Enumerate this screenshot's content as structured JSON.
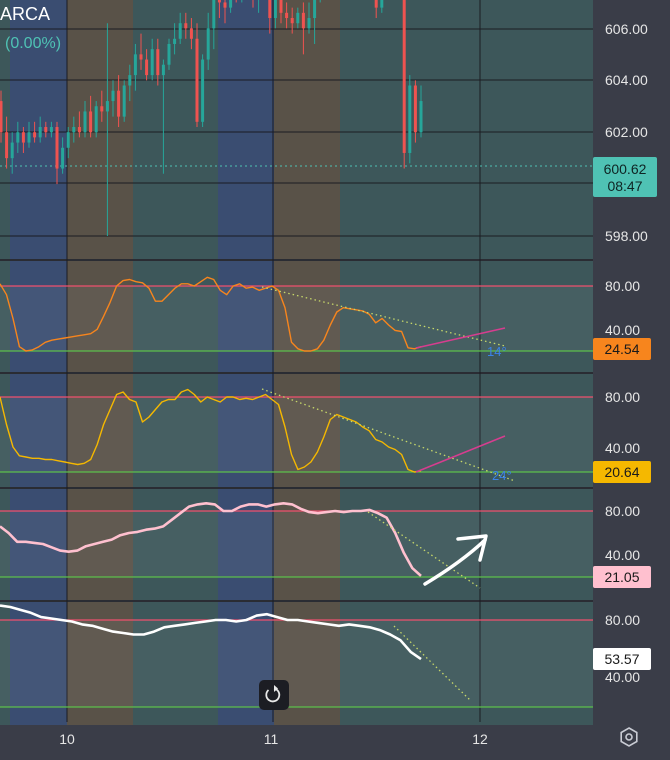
{
  "header": {
    "symbol": "ARCA",
    "change": "(0.00%)"
  },
  "colors": {
    "background": "#3a3d48",
    "zone_blue": "#3b4f75",
    "zone_orange": "#5d5448",
    "zone_teal": "#3e5a5c",
    "candle_up": "#26a69a",
    "candle_down": "#ef5350",
    "grid": "#1b1c22",
    "upper_band": "#f0506e",
    "lower_band": "#5cc04b",
    "osc1": "#f7851d",
    "osc2": "#f5b800",
    "osc3": "#ffc0cf",
    "osc4": "#ffffff",
    "trend_up_line": "#d63d8f",
    "trend_down_dots": "#c7d86a",
    "angle_text": "#3b82e8",
    "price_badge": "#4fc2b4"
  },
  "x_axis": {
    "labels": [
      "10",
      "11",
      "12"
    ]
  },
  "settings_icon": "gear-icon",
  "reset_icon": "reset-icon",
  "chart_data": [
    {
      "type": "candlestick",
      "title": "ARCA",
      "y_ticks": [
        "606.00",
        "604.00",
        "602.00",
        "598.00"
      ],
      "ylim": [
        597.9,
        607.2
      ],
      "last_price": "600.62",
      "countdown": "08:47",
      "grid": true,
      "candles": [
        {
          "o": 600.6,
          "h": 600.8,
          "l": 599.8,
          "c": 600.0
        },
        {
          "o": 600.0,
          "h": 600.3,
          "l": 599.3,
          "c": 599.5
        },
        {
          "o": 599.5,
          "h": 600.0,
          "l": 599.2,
          "c": 599.8
        },
        {
          "o": 599.8,
          "h": 600.2,
          "l": 599.6,
          "c": 600.0
        },
        {
          "o": 600.0,
          "h": 600.1,
          "l": 599.6,
          "c": 599.8
        },
        {
          "o": 599.8,
          "h": 600.2,
          "l": 599.7,
          "c": 600.0
        },
        {
          "o": 600.0,
          "h": 600.2,
          "l": 599.8,
          "c": 599.9
        },
        {
          "o": 599.9,
          "h": 600.3,
          "l": 599.8,
          "c": 600.1
        },
        {
          "o": 600.1,
          "h": 600.2,
          "l": 599.9,
          "c": 600.0
        },
        {
          "o": 600.0,
          "h": 600.2,
          "l": 599.9,
          "c": 600.1
        },
        {
          "o": 600.1,
          "h": 600.2,
          "l": 599.0,
          "c": 599.3
        },
        {
          "o": 599.3,
          "h": 599.9,
          "l": 599.2,
          "c": 599.7
        },
        {
          "o": 599.7,
          "h": 600.1,
          "l": 599.5,
          "c": 600.0
        },
        {
          "o": 600.0,
          "h": 600.3,
          "l": 599.8,
          "c": 600.1
        },
        {
          "o": 600.1,
          "h": 600.4,
          "l": 599.9,
          "c": 600.0
        },
        {
          "o": 600.0,
          "h": 600.6,
          "l": 599.9,
          "c": 600.4
        },
        {
          "o": 600.4,
          "h": 600.7,
          "l": 599.9,
          "c": 600.0
        },
        {
          "o": 600.0,
          "h": 600.6,
          "l": 599.9,
          "c": 600.5
        },
        {
          "o": 600.5,
          "h": 600.8,
          "l": 600.2,
          "c": 600.4
        },
        {
          "o": 600.4,
          "h": 602.1,
          "l": 598.0,
          "c": 600.6
        },
        {
          "o": 600.6,
          "h": 601.0,
          "l": 600.3,
          "c": 600.8
        },
        {
          "o": 600.8,
          "h": 601.1,
          "l": 600.1,
          "c": 600.3
        },
        {
          "o": 600.3,
          "h": 601.0,
          "l": 600.2,
          "c": 600.9
        },
        {
          "o": 600.9,
          "h": 601.3,
          "l": 600.6,
          "c": 601.1
        },
        {
          "o": 601.1,
          "h": 601.7,
          "l": 600.8,
          "c": 601.5
        },
        {
          "o": 601.5,
          "h": 601.9,
          "l": 601.2,
          "c": 601.4
        },
        {
          "o": 601.4,
          "h": 601.6,
          "l": 601.0,
          "c": 601.1
        },
        {
          "o": 601.1,
          "h": 601.8,
          "l": 601.0,
          "c": 601.6
        },
        {
          "o": 601.6,
          "h": 601.8,
          "l": 600.9,
          "c": 601.1
        },
        {
          "o": 601.1,
          "h": 601.4,
          "l": 599.2,
          "c": 601.3
        },
        {
          "o": 601.3,
          "h": 601.8,
          "l": 601.2,
          "c": 601.7
        },
        {
          "o": 601.7,
          "h": 602.1,
          "l": 601.5,
          "c": 601.8
        },
        {
          "o": 601.8,
          "h": 602.3,
          "l": 601.7,
          "c": 602.1
        },
        {
          "o": 602.1,
          "h": 602.3,
          "l": 601.8,
          "c": 602.0
        },
        {
          "o": 602.0,
          "h": 602.2,
          "l": 601.6,
          "c": 601.8
        },
        {
          "o": 601.8,
          "h": 602.1,
          "l": 600.1,
          "c": 600.2
        },
        {
          "o": 600.2,
          "h": 601.5,
          "l": 600.1,
          "c": 601.4
        },
        {
          "o": 601.4,
          "h": 602.3,
          "l": 601.2,
          "c": 602.0
        },
        {
          "o": 602.0,
          "h": 602.9,
          "l": 601.6,
          "c": 602.8
        },
        {
          "o": 602.8,
          "h": 603.1,
          "l": 602.2,
          "c": 602.5
        },
        {
          "o": 602.5,
          "h": 602.9,
          "l": 602.1,
          "c": 602.4
        },
        {
          "o": 602.4,
          "h": 603.0,
          "l": 602.3,
          "c": 602.9
        },
        {
          "o": 602.9,
          "h": 603.2,
          "l": 602.5,
          "c": 602.7
        },
        {
          "o": 602.7,
          "h": 603.0,
          "l": 602.5,
          "c": 602.8
        },
        {
          "o": 602.8,
          "h": 603.1,
          "l": 602.6,
          "c": 602.7
        },
        {
          "o": 602.7,
          "h": 603.0,
          "l": 602.4,
          "c": 602.6
        },
        {
          "o": 602.6,
          "h": 602.9,
          "l": 602.3,
          "c": 602.8
        },
        {
          "o": 602.8,
          "h": 603.6,
          "l": 602.7,
          "c": 603.1
        },
        {
          "o": 603.1,
          "h": 603.3,
          "l": 601.9,
          "c": 602.2
        },
        {
          "o": 602.2,
          "h": 602.8,
          "l": 602.0,
          "c": 602.6
        },
        {
          "o": 602.6,
          "h": 602.7,
          "l": 602.1,
          "c": 602.3
        },
        {
          "o": 602.3,
          "h": 602.5,
          "l": 602.0,
          "c": 602.2
        },
        {
          "o": 602.2,
          "h": 602.4,
          "l": 601.9,
          "c": 602.1
        },
        {
          "o": 602.1,
          "h": 602.4,
          "l": 602.0,
          "c": 602.3
        },
        {
          "o": 602.3,
          "h": 602.5,
          "l": 601.5,
          "c": 602.0
        },
        {
          "o": 602.0,
          "h": 602.5,
          "l": 601.9,
          "c": 602.2
        },
        {
          "o": 602.2,
          "h": 602.8,
          "l": 601.7,
          "c": 602.7
        },
        {
          "o": 602.7,
          "h": 603.7,
          "l": 602.5,
          "c": 603.5
        },
        {
          "o": 603.5,
          "h": 604.0,
          "l": 603.0,
          "c": 603.1
        },
        {
          "o": 603.1,
          "h": 606.6,
          "l": 602.9,
          "c": 604.4
        },
        {
          "o": 604.4,
          "h": 604.6,
          "l": 603.5,
          "c": 603.7
        },
        {
          "o": 603.7,
          "h": 604.2,
          "l": 603.0,
          "c": 603.2
        },
        {
          "o": 603.2,
          "h": 605.1,
          "l": 603.1,
          "c": 604.8
        },
        {
          "o": 604.8,
          "h": 605.2,
          "l": 604.5,
          "c": 605.0
        },
        {
          "o": 605.0,
          "h": 605.2,
          "l": 604.2,
          "c": 604.4
        },
        {
          "o": 604.4,
          "h": 604.7,
          "l": 604.0,
          "c": 604.5
        },
        {
          "o": 604.5,
          "h": 604.9,
          "l": 603.6,
          "c": 603.8
        },
        {
          "o": 603.8,
          "h": 604.1,
          "l": 602.2,
          "c": 602.4
        },
        {
          "o": 602.4,
          "h": 603.7,
          "l": 602.3,
          "c": 603.5
        },
        {
          "o": 603.5,
          "h": 603.9,
          "l": 602.9,
          "c": 603.1
        },
        {
          "o": 603.1,
          "h": 604.7,
          "l": 603.0,
          "c": 604.6
        },
        {
          "o": 604.6,
          "h": 604.7,
          "l": 602.8,
          "c": 603.1
        },
        {
          "o": 603.1,
          "h": 603.2,
          "l": 599.3,
          "c": 599.6
        },
        {
          "o": 599.6,
          "h": 601.1,
          "l": 599.4,
          "c": 600.9
        },
        {
          "o": 600.9,
          "h": 601.0,
          "l": 599.8,
          "c": 600.0
        },
        {
          "o": 600.0,
          "h": 600.9,
          "l": 599.9,
          "c": 600.6
        }
      ]
    },
    {
      "type": "line",
      "value_label": "24.54",
      "y_ticks": [
        "80.00",
        "40.00"
      ],
      "ylim": [
        10,
        100
      ],
      "bands": [
        80,
        20
      ],
      "angle_label": "14°",
      "values": [
        82,
        72,
        50,
        24,
        20,
        21,
        24,
        28,
        30,
        31,
        32,
        33,
        34,
        35,
        36,
        40,
        52,
        65,
        80,
        85,
        86,
        84,
        83,
        78,
        66,
        66,
        72,
        78,
        82,
        82,
        80,
        84,
        88,
        86,
        76,
        72,
        80,
        82,
        78,
        79,
        76,
        78,
        80,
        76,
        60,
        28,
        22,
        20,
        20,
        22,
        30,
        44,
        56,
        60,
        59,
        58,
        57,
        54,
        46,
        50,
        44,
        39,
        38,
        23,
        22,
        24
      ]
    },
    {
      "type": "line",
      "value_label": "20.64",
      "y_ticks": [
        "80.00",
        "40.00"
      ],
      "ylim": [
        10,
        100
      ],
      "bands": [
        80,
        20
      ],
      "angle_label": "24°",
      "values": [
        80,
        58,
        40,
        33,
        32,
        31,
        31,
        30,
        30,
        29,
        28,
        27,
        26,
        27,
        30,
        42,
        58,
        70,
        82,
        84,
        78,
        76,
        60,
        64,
        70,
        76,
        78,
        78,
        84,
        86,
        82,
        76,
        80,
        78,
        76,
        80,
        80,
        78,
        79,
        78,
        80,
        82,
        78,
        74,
        56,
        34,
        22,
        24,
        28,
        36,
        48,
        62,
        66,
        64,
        62,
        60,
        56,
        53,
        46,
        44,
        40,
        38,
        34,
        22,
        20,
        21
      ]
    },
    {
      "type": "line",
      "value_label": "21.05",
      "y_ticks": [
        "80.00",
        "40.00"
      ],
      "ylim": [
        10,
        100
      ],
      "bands": [
        80,
        20
      ],
      "values": [
        66,
        60,
        52,
        52,
        51,
        50,
        47,
        44,
        43,
        44,
        48,
        50,
        52,
        54,
        58,
        60,
        61,
        63,
        64,
        66,
        72,
        78,
        84,
        86,
        87,
        86,
        80,
        80,
        84,
        86,
        86,
        84,
        86,
        87,
        86,
        82,
        79,
        78,
        79,
        80,
        79,
        80,
        80,
        81,
        78,
        74,
        60,
        42,
        28,
        21
      ]
    },
    {
      "type": "line",
      "value_label": "53.57",
      "y_ticks": [
        "80.00",
        "40.00"
      ],
      "ylim": [
        10,
        100
      ],
      "bands": [
        80,
        20
      ],
      "values": [
        90,
        89,
        87,
        85,
        82,
        81,
        80,
        79,
        77,
        76,
        74,
        72,
        71,
        70,
        70,
        72,
        75,
        76,
        77,
        78,
        79,
        80,
        80,
        79,
        80,
        83,
        84,
        82,
        80,
        80,
        79,
        78,
        77,
        76,
        77,
        76,
        75,
        73,
        70,
        66,
        58,
        53
      ]
    }
  ]
}
